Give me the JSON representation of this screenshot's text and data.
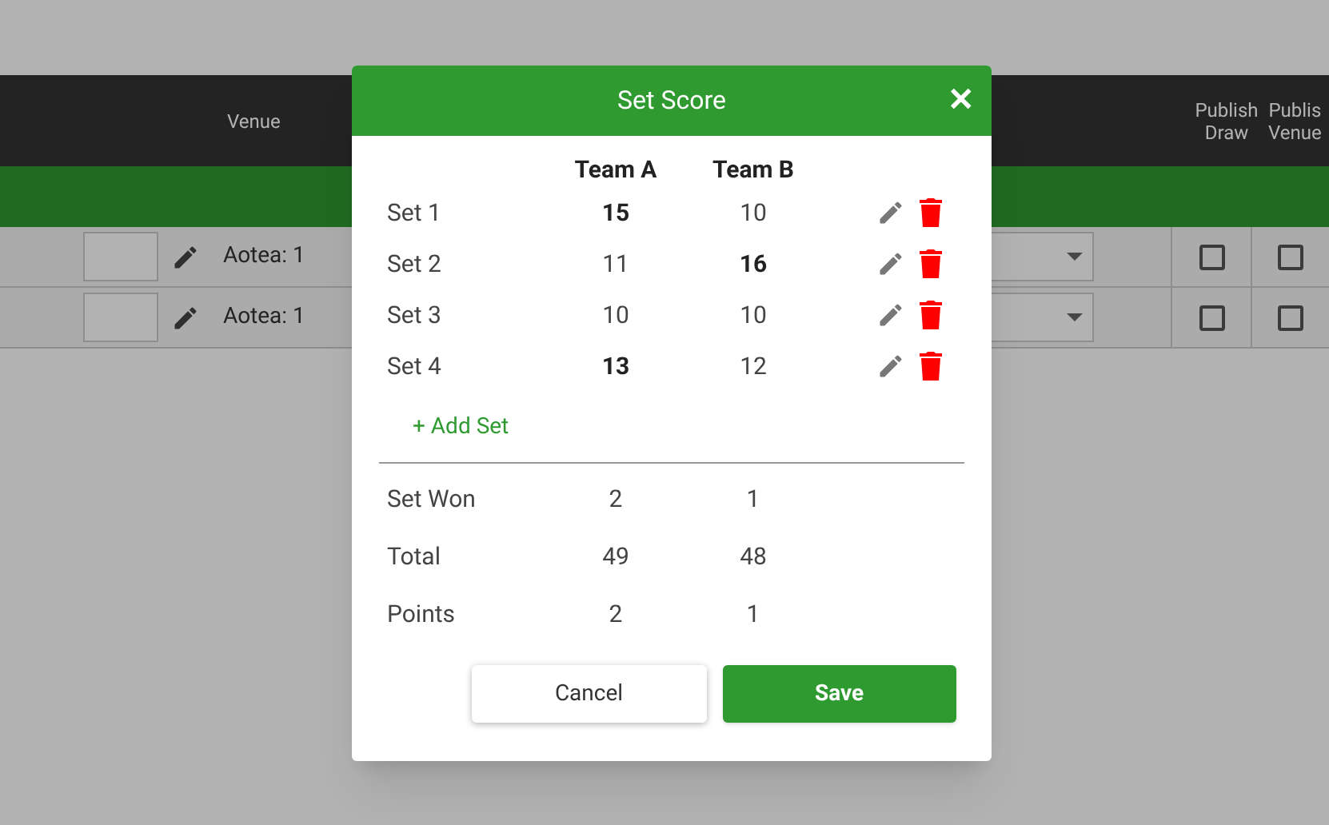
{
  "background": {
    "header": {
      "venue": "Venue",
      "publish_draw": "Publish Draw",
      "publish_venue": "Publis Venue"
    },
    "rows": [
      {
        "venue": "Aotea: 1",
        "publish_draw": false,
        "publish_venue": false
      },
      {
        "venue": "Aotea: 1",
        "publish_draw": false,
        "publish_venue": false
      }
    ]
  },
  "dialog": {
    "title": "Set Score",
    "close": "✕",
    "columns": [
      "Team A",
      "Team B"
    ],
    "sets": [
      {
        "label": "Set 1",
        "team_a": "15",
        "team_b": "10",
        "a_bold": true,
        "b_bold": false
      },
      {
        "label": "Set 2",
        "team_a": "11",
        "team_b": "16",
        "a_bold": false,
        "b_bold": true
      },
      {
        "label": "Set 3",
        "team_a": "10",
        "team_b": "10",
        "a_bold": false,
        "b_bold": false
      },
      {
        "label": "Set 4",
        "team_a": "13",
        "team_b": "12",
        "a_bold": true,
        "b_bold": false
      }
    ],
    "add_set": "+ Add Set",
    "summary": [
      {
        "label": "Set Won",
        "team_a": "2",
        "team_b": "1"
      },
      {
        "label": "Total",
        "team_a": "49",
        "team_b": "48"
      },
      {
        "label": "Points",
        "team_a": "2",
        "team_b": "1"
      }
    ],
    "cancel": "Cancel",
    "save": "Save"
  }
}
